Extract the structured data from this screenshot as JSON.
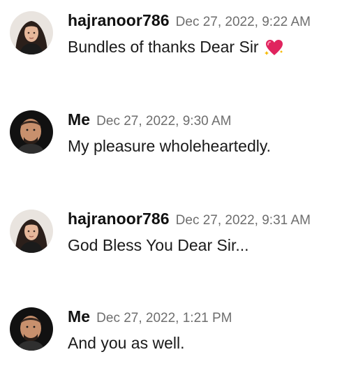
{
  "messages": [
    {
      "username": "hajranoor786",
      "timestamp": "Dec 27, 2022, 9:22 AM",
      "text": "Bundles of thanks Dear Sir",
      "avatar": "female-avatar-icon",
      "emoji": "sparkling-heart-icon"
    },
    {
      "username": "Me",
      "timestamp": "Dec 27, 2022, 9:30 AM",
      "text": "My pleasure wholeheartedly.",
      "avatar": "male-avatar-icon"
    },
    {
      "username": "hajranoor786",
      "timestamp": "Dec 27, 2022, 9:31 AM",
      "text": "God Bless You Dear Sir...",
      "avatar": "female-avatar-icon"
    },
    {
      "username": "Me",
      "timestamp": "Dec 27, 2022, 1:21 PM",
      "text": "And you as well.",
      "avatar": "male-avatar-icon"
    }
  ],
  "colors": {
    "text": "#1a1a1a",
    "timestamp": "#6e6e6e",
    "heart": "#e0245e"
  }
}
